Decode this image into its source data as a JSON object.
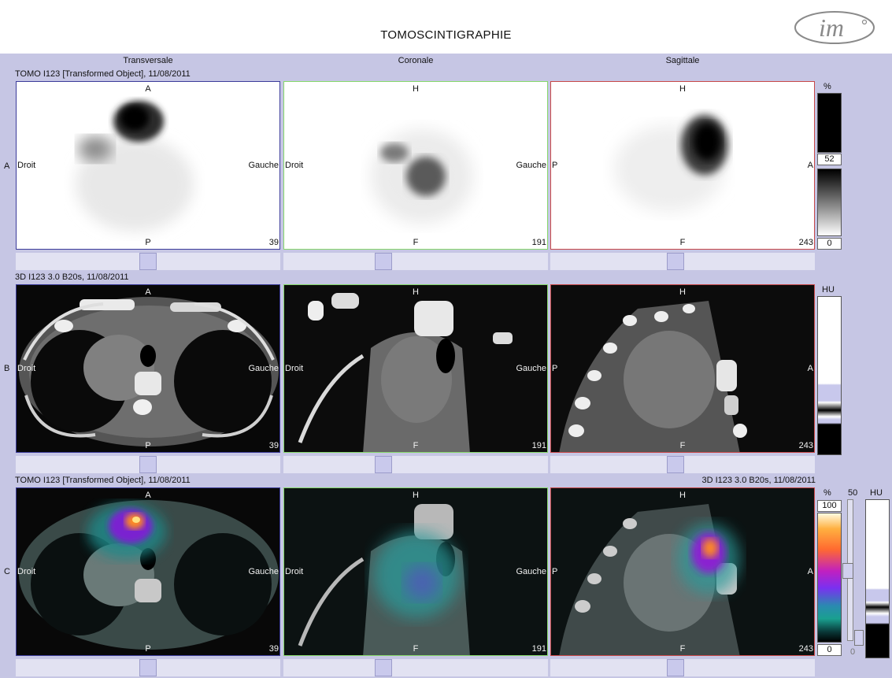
{
  "header": {
    "title": "TOMOSCINTIGRAPHIE",
    "logo_text": "im"
  },
  "columns": [
    "Transversale",
    "Coronale",
    "Sagittale"
  ],
  "rows": [
    {
      "letter": "A",
      "caption": "TOMO I123 [Transformed Object], 11/08/2011"
    },
    {
      "letter": "B",
      "caption": "3D I123  3.0  B20s, 11/08/2011"
    },
    {
      "letter": "C",
      "caption": "TOMO I123 [Transformed Object], 11/08/2011",
      "caption_right": "3D I123  3.0  B20s, 11/08/2011"
    }
  ],
  "views": {
    "transversal": {
      "top": "A",
      "bottom": "P",
      "left": "Droit",
      "right": "Gauche",
      "slice": "39"
    },
    "coronal": {
      "top": "H",
      "bottom": "F",
      "left": "Droit",
      "right": "Gauche",
      "slice": "191"
    },
    "sagittal": {
      "top": "H",
      "bottom": "F",
      "left": "P",
      "right": "A",
      "slice": "243"
    }
  },
  "scales": {
    "row_a": {
      "unit": "%",
      "mid": "52",
      "min": "0"
    },
    "row_b": {
      "unit": "HU"
    },
    "row_c": {
      "unit": "%",
      "max": "100",
      "min": "0",
      "slider_max": "50",
      "slider_min": "0",
      "unit2": "HU"
    }
  },
  "colors": {
    "background": "#c6c6e4",
    "transversal_frame": "#3c3c9a",
    "coronal_frame": "#86d86a",
    "sagittal_frame": "#c84848"
  }
}
